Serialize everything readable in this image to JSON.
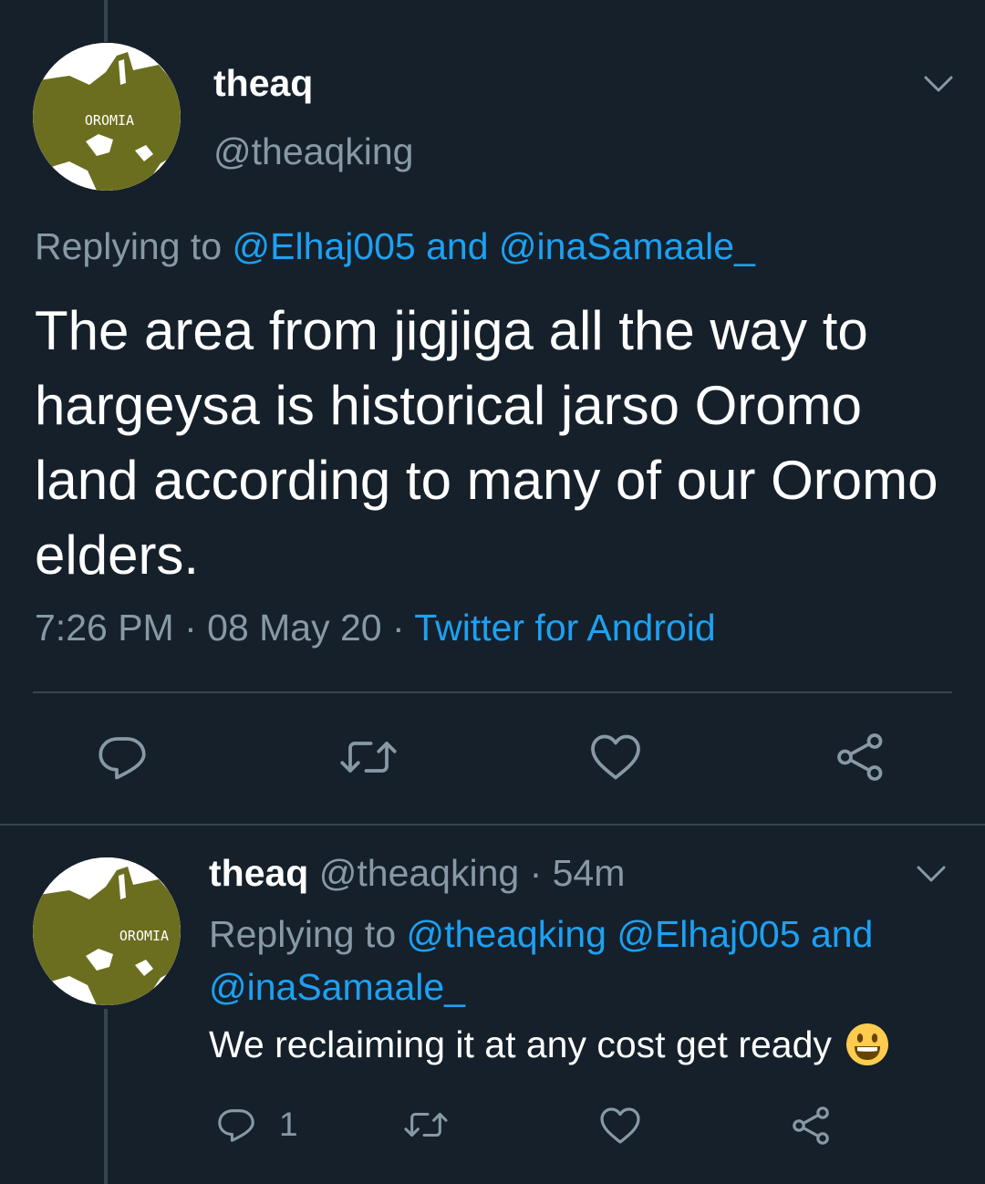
{
  "main_tweet": {
    "display_name": "theaq",
    "handle": "@theaqking",
    "avatar_label": "OROMIA",
    "replying_prefix": "Replying to ",
    "replying_user1": "@Elhaj005",
    "replying_and": " and ",
    "replying_user2": "@inaSamaale_",
    "text": "The area from jigjiga all the way to hargeysa is historical jarso Oromo land according to many of our Oromo elders.",
    "time": "7:26 PM",
    "sep1": " · ",
    "date": "08 May 20",
    "sep2": " · ",
    "source": "Twitter for Android"
  },
  "reply_tweet": {
    "display_name": "theaq",
    "handle": " @theaqking",
    "sep": " · ",
    "age": "54m",
    "avatar_label": "OROMIA",
    "replying_prefix": "Replying to ",
    "replying_user1": "@theaqking",
    "replying_user2": " @Elhaj005",
    "replying_and": " and ",
    "replying_user3": "@inaSamaale_",
    "text": "We reclaiming it at any cost get ready",
    "reply_count": "1"
  },
  "icons": {
    "reply": "reply-icon",
    "retweet": "retweet-icon",
    "like": "heart-icon",
    "share": "share-icon",
    "more": "chevron-down-icon",
    "emoji": "smiley-emoji"
  },
  "colors": {
    "background": "#15202b",
    "link": "#1da1f2",
    "secondary_text": "#8899a6",
    "divider": "#38444d"
  }
}
